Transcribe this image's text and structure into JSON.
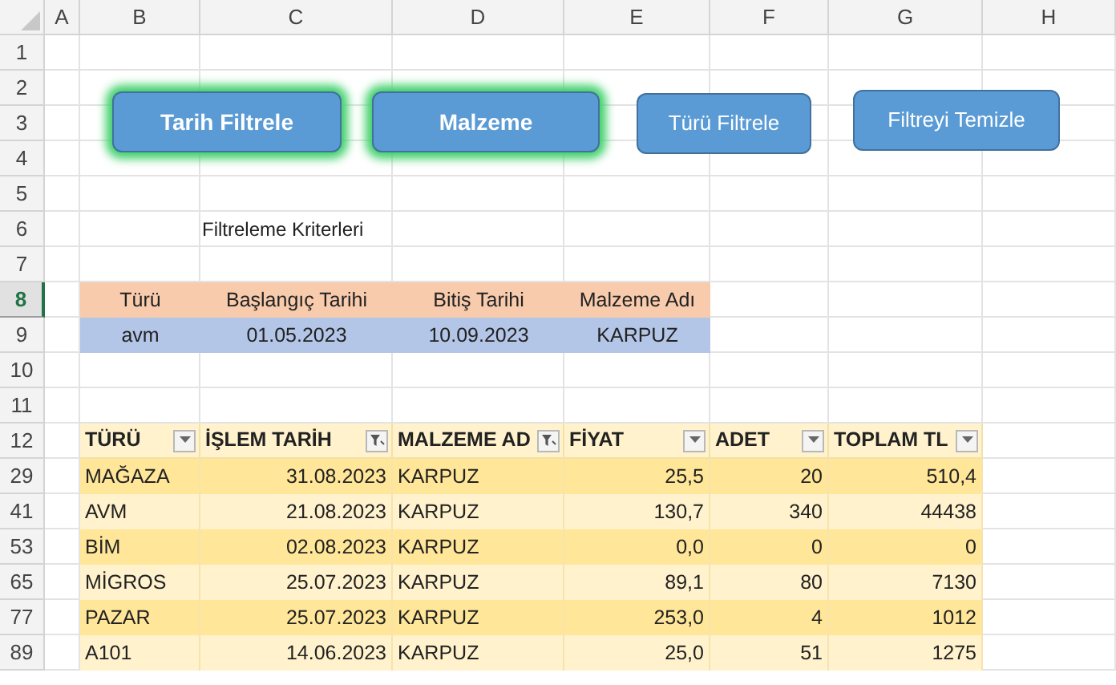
{
  "sheet": {
    "columns": [
      "A",
      "B",
      "C",
      "D",
      "E",
      "F",
      "G",
      "H"
    ],
    "rows": [
      {
        "label": "1",
        "selected": false
      },
      {
        "label": "2",
        "selected": false
      },
      {
        "label": "3",
        "selected": false
      },
      {
        "label": "4",
        "selected": false
      },
      {
        "label": "5",
        "selected": false
      },
      {
        "label": "6",
        "selected": false
      },
      {
        "label": "7",
        "selected": false
      },
      {
        "label": "8",
        "selected": true
      },
      {
        "label": "9",
        "selected": false
      },
      {
        "label": "10",
        "selected": false
      },
      {
        "label": "11",
        "selected": false
      },
      {
        "label": "12",
        "selected": false
      },
      {
        "label": "29",
        "selected": false
      },
      {
        "label": "41",
        "selected": false
      },
      {
        "label": "53",
        "selected": false
      },
      {
        "label": "65",
        "selected": false
      },
      {
        "label": "77",
        "selected": false
      },
      {
        "label": "89",
        "selected": false
      }
    ]
  },
  "buttons": [
    {
      "label": "Tarih Filtrele",
      "highlighted": true
    },
    {
      "label": "Malzeme",
      "highlighted": true
    },
    {
      "label": "Türü Filtrele",
      "highlighted": false
    },
    {
      "label": "Filtreyi Temizle",
      "highlighted": false
    }
  ],
  "criteria_title": "Filtreleme Kriterleri",
  "criteria": {
    "headers": [
      "Türü",
      "Başlangıç Tarihi",
      "Bitiş Tarihi",
      "Malzeme Adı"
    ],
    "values": [
      "avm",
      "01.05.2023",
      "10.09.2023",
      "KARPUZ"
    ]
  },
  "table": {
    "columns": [
      {
        "label": "TÜRÜ",
        "filtered": false
      },
      {
        "label": "İŞLEM TARİH",
        "filtered": true
      },
      {
        "label": "MALZEME AD",
        "filtered": true
      },
      {
        "label": "FİYAT",
        "filtered": false
      },
      {
        "label": "ADET",
        "filtered": false
      },
      {
        "label": "TOPLAM TL",
        "filtered": false
      }
    ],
    "rows": [
      [
        "MAĞAZA",
        "31.08.2023",
        "KARPUZ",
        "25,5",
        "20",
        "510,4"
      ],
      [
        "AVM",
        "21.08.2023",
        "KARPUZ",
        "130,7",
        "340",
        "44438"
      ],
      [
        "BİM",
        "02.08.2023",
        "KARPUZ",
        "0,0",
        "0",
        "0"
      ],
      [
        "MİGROS",
        "25.07.2023",
        "KARPUZ",
        "89,1",
        "80",
        "7130"
      ],
      [
        "PAZAR",
        "25.07.2023",
        "KARPUZ",
        "253,0",
        "4",
        "1012"
      ],
      [
        "A101",
        "14.06.2023",
        "KARPUZ",
        "25,0",
        "51",
        "1275"
      ]
    ]
  }
}
